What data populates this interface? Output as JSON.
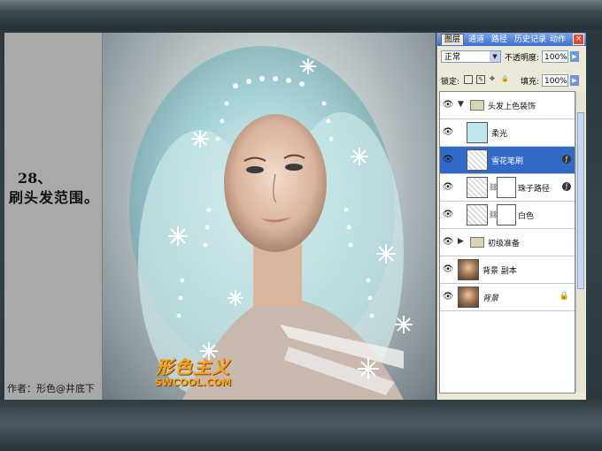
{
  "tutorial": {
    "step_number": "28、",
    "step_text": "刷头发范围。",
    "author": "作者：形色@井底下"
  },
  "watermark": {
    "logo_text": "形色主义",
    "site": "SWCOOL.COM"
  },
  "layers_panel": {
    "tabs": [
      {
        "label": "图层",
        "active": true
      },
      {
        "label": "通道",
        "active": false
      },
      {
        "label": "路径",
        "active": false
      },
      {
        "label": "历史记录",
        "active": false
      },
      {
        "label": "动作",
        "active": false
      }
    ],
    "close_label": "×",
    "blend_mode": "正常",
    "opacity_label": "不透明度:",
    "opacity_value": "100%",
    "lock_label": "锁定:",
    "fill_label": "填充:",
    "fill_value": "100%",
    "layers": [
      {
        "name": "头发上色装饰",
        "type": "group",
        "expanded": true
      },
      {
        "name": "柔光",
        "type": "layer",
        "thumb": "cyan"
      },
      {
        "name": "雪花笔刷",
        "type": "layer",
        "thumb": "transparent",
        "selected": true,
        "fx": true
      },
      {
        "name": "珠子路径",
        "type": "layer",
        "thumb": "transparent",
        "mask": true,
        "fx": true
      },
      {
        "name": "白色",
        "type": "layer",
        "thumb": "transparent",
        "mask": true
      },
      {
        "name": "初级准备",
        "type": "group",
        "expanded": false
      },
      {
        "name": "背景 副本",
        "type": "layer",
        "thumb": "photo"
      },
      {
        "name": "背景",
        "type": "layer",
        "thumb": "photo",
        "locked": true
      }
    ]
  },
  "colors": {
    "accent_selected": "#3169c6",
    "watermark_orange": "#f7a21b",
    "panel_bg": "#ece9d8"
  }
}
